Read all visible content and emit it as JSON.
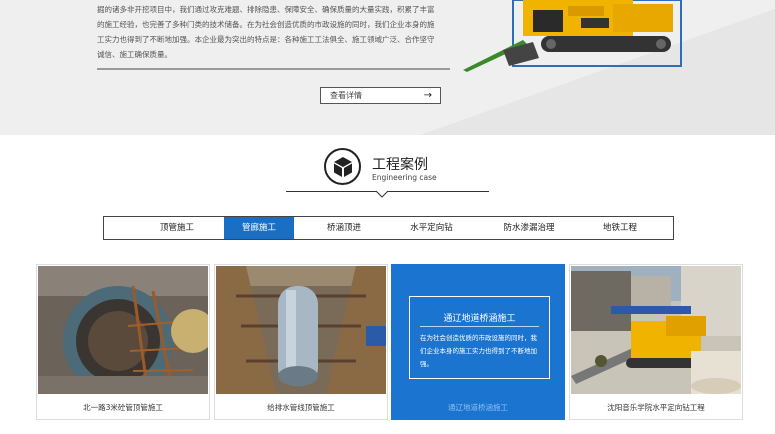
{
  "intro": {
    "lines": [
      "掘的诸多非开挖项目中，我们通过攻克难题、排除隐患、保障安全、确保质量的大量实践，积累了丰富",
      "的施工经验，也完善了多种门类的技术储备。在为社会创造优质的市政设施的同时，我们企业本身的施",
      "工实力也得到了不断地加强。本企业最为突出的特点是：各种施工工法俱全、施工领域广泛、合作坚守",
      "诚信、施工确保质量。"
    ],
    "more_label": "查看详情",
    "more_arrow": "→"
  },
  "section": {
    "title_cn": "工程案例",
    "title_en": "Engineering case",
    "icon": "cube-icon"
  },
  "tabs": [
    {
      "label": "顶管施工",
      "active": false
    },
    {
      "label": "管廊施工",
      "active": true
    },
    {
      "label": "桥涵顶进",
      "active": false
    },
    {
      "label": "水平定向钻",
      "active": false
    },
    {
      "label": "防水渗漏治理",
      "active": false
    },
    {
      "label": "地铁工程",
      "active": false
    }
  ],
  "cards": [
    {
      "caption": "北一路3米砼管顶管施工"
    },
    {
      "caption": "给排水管线顶管施工"
    },
    {
      "caption": "通辽地道桥涵施工",
      "overlay_title": "通辽地道桥涵施工",
      "overlay_body": "在为社会创造优质的市政设施的同时，我们企业本身的施工实力也得到了不断地加强。"
    },
    {
      "caption": "沈阳音乐学院水平定向钻工程"
    }
  ],
  "colors": {
    "accent": "#1a6fc4",
    "machine": "#f0b400"
  }
}
